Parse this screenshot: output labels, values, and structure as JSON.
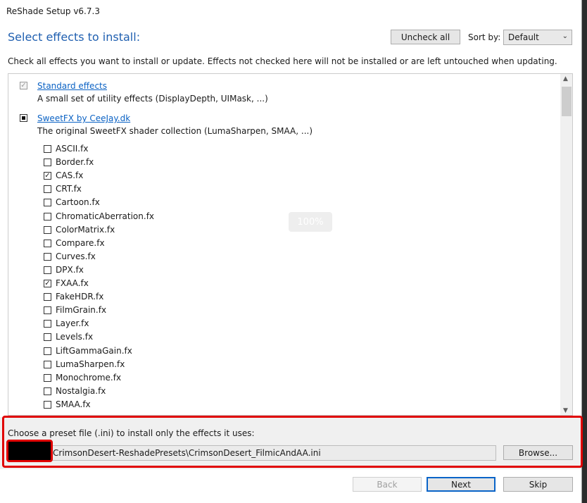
{
  "window": {
    "title": "ReShade Setup v6.7.3"
  },
  "header": {
    "heading": "Select effects to install:",
    "uncheck_all": "Uncheck all",
    "sort_label": "Sort by:",
    "sort_value": "Default"
  },
  "description": "Check all effects you want to install or update. Effects not checked here will not be installed or are left untouched when updating.",
  "groups": [
    {
      "name": "Standard effects",
      "description": "A small set of utility effects (DisplayDepth, UIMask, ...)",
      "state": "checked-disabled"
    },
    {
      "name": "SweetFX by CeeJay.dk",
      "description": "The original SweetFX shader collection (LumaSharpen, SMAA, ...)",
      "state": "partial"
    }
  ],
  "effects": [
    {
      "name": "ASCII.fx",
      "checked": false
    },
    {
      "name": "Border.fx",
      "checked": false
    },
    {
      "name": "CAS.fx",
      "checked": true
    },
    {
      "name": "CRT.fx",
      "checked": false
    },
    {
      "name": "Cartoon.fx",
      "checked": false
    },
    {
      "name": "ChromaticAberration.fx",
      "checked": false
    },
    {
      "name": "ColorMatrix.fx",
      "checked": false
    },
    {
      "name": "Compare.fx",
      "checked": false
    },
    {
      "name": "Curves.fx",
      "checked": false
    },
    {
      "name": "DPX.fx",
      "checked": false
    },
    {
      "name": "FXAA.fx",
      "checked": true
    },
    {
      "name": "FakeHDR.fx",
      "checked": false
    },
    {
      "name": "FilmGrain.fx",
      "checked": false
    },
    {
      "name": "Layer.fx",
      "checked": false
    },
    {
      "name": "Levels.fx",
      "checked": false
    },
    {
      "name": "LiftGammaGain.fx",
      "checked": false
    },
    {
      "name": "LumaSharpen.fx",
      "checked": false
    },
    {
      "name": "Monochrome.fx",
      "checked": false
    },
    {
      "name": "Nostalgia.fx",
      "checked": false
    },
    {
      "name": "SMAA.fx",
      "checked": false
    }
  ],
  "progress": "100%",
  "preset": {
    "label": "Choose a preset file (.ini) to install only the effects it uses:",
    "path": "CrimsonDesert-ReshadePresets\\CrimsonDesert_FilmicAndAA.ini",
    "browse": "Browse..."
  },
  "footer": {
    "back": "Back",
    "next": "Next",
    "skip": "Skip"
  },
  "colors": {
    "accent": "#1f5fb0",
    "link": "#0b62c4",
    "highlight": "#e00000"
  }
}
